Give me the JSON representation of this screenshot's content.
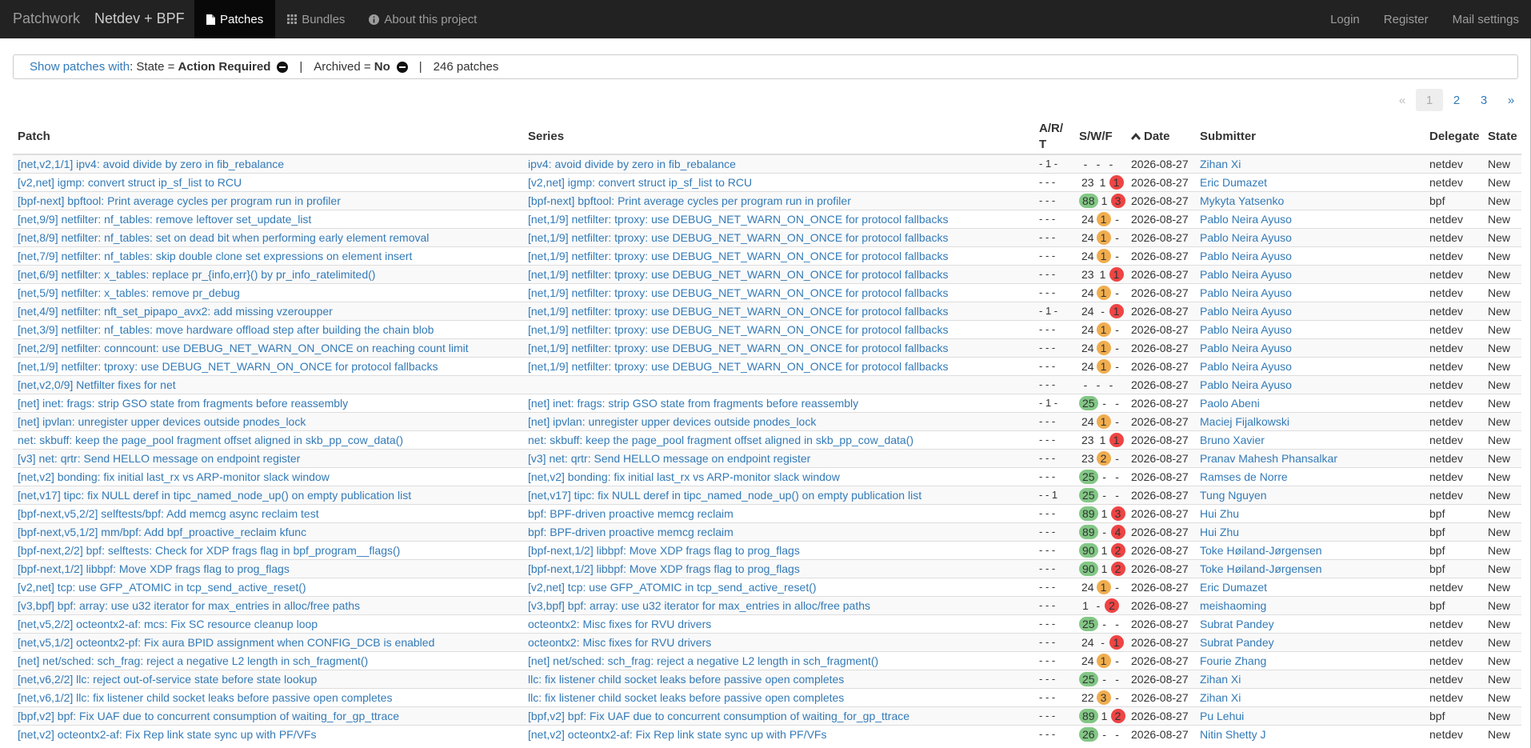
{
  "nav": {
    "brand": "Patchwork",
    "project": "Netdev + BPF",
    "tabs": [
      {
        "label": "Patches",
        "icon": "file-icon",
        "active": true
      },
      {
        "label": "Bundles",
        "icon": "th-icon",
        "active": false
      },
      {
        "label": "About this project",
        "icon": "info-icon",
        "active": false
      }
    ],
    "right": [
      "Login",
      "Register",
      "Mail settings"
    ]
  },
  "filters": {
    "show_label": "Show patches with",
    "state_prefix": ": State = ",
    "state_value": "Action Required",
    "sep1": "|",
    "archived_prefix": "Archived = ",
    "archived_value": "No",
    "sep2": "|",
    "count": "246 patches"
  },
  "pagination": {
    "prev": "«",
    "pages": [
      "1",
      "2",
      "3"
    ],
    "next": "»",
    "current": "1"
  },
  "table": {
    "headers": {
      "patch": "Patch",
      "series": "Series",
      "art": "A/R/T",
      "swf": "S/W/F",
      "date": "Date",
      "submitter": "Submitter",
      "delegate": "Delegate",
      "state": "State"
    },
    "rows": [
      {
        "patch": "[net,v2,1/1] ipv4: avoid divide by zero in fib_rebalance",
        "series": "ipv4: avoid divide by zero in fib_rebalance",
        "art": "- 1 -",
        "s": "-",
        "w": "-",
        "f": "-",
        "date": "2026-08-27",
        "submitter": "Zihan Xi",
        "delegate": "netdev",
        "state": "New"
      },
      {
        "patch": "[v2,net] igmp: convert struct ip_sf_list to RCU",
        "series": "[v2,net] igmp: convert struct ip_sf_list to RCU",
        "art": "- - -",
        "s": "23",
        "w": "1",
        "f": "1",
        "date": "2026-08-27",
        "submitter": "Eric Dumazet",
        "delegate": "netdev",
        "state": "New"
      },
      {
        "patch": "[bpf-next] bpftool: Print average cycles per program run in profiler",
        "series": "[bpf-next] bpftool: Print average cycles per program run in profiler",
        "art": "- - -",
        "s": "88",
        "w": "1",
        "f": "3",
        "date": "2026-08-27",
        "submitter": "Mykyta Yatsenko",
        "delegate": "bpf",
        "state": "New"
      },
      {
        "patch": "[net,9/9] netfilter: nf_tables: remove leftover set_update_list",
        "series": "[net,1/9] netfilter: tproxy: use DEBUG_NET_WARN_ON_ONCE for protocol fallbacks",
        "art": "- - -",
        "s": "24",
        "w": "1",
        "f": "-",
        "date": "2026-08-27",
        "submitter": "Pablo Neira Ayuso",
        "delegate": "netdev",
        "state": "New"
      },
      {
        "patch": "[net,8/9] netfilter: nf_tables: set on dead bit when performing early element removal",
        "series": "[net,1/9] netfilter: tproxy: use DEBUG_NET_WARN_ON_ONCE for protocol fallbacks",
        "art": "- - -",
        "s": "24",
        "w": "1",
        "f": "-",
        "date": "2026-08-27",
        "submitter": "Pablo Neira Ayuso",
        "delegate": "netdev",
        "state": "New"
      },
      {
        "patch": "[net,7/9] netfilter: nf_tables: skip double clone set expressions on element insert",
        "series": "[net,1/9] netfilter: tproxy: use DEBUG_NET_WARN_ON_ONCE for protocol fallbacks",
        "art": "- - -",
        "s": "24",
        "w": "1",
        "f": "-",
        "date": "2026-08-27",
        "submitter": "Pablo Neira Ayuso",
        "delegate": "netdev",
        "state": "New"
      },
      {
        "patch": "[net,6/9] netfilter: x_tables: replace pr_{info,err}() by pr_info_ratelimited()",
        "series": "[net,1/9] netfilter: tproxy: use DEBUG_NET_WARN_ON_ONCE for protocol fallbacks",
        "art": "- - -",
        "s": "23",
        "w": "1",
        "f": "1",
        "date": "2026-08-27",
        "submitter": "Pablo Neira Ayuso",
        "delegate": "netdev",
        "state": "New"
      },
      {
        "patch": "[net,5/9] netfilter: x_tables: remove pr_debug",
        "series": "[net,1/9] netfilter: tproxy: use DEBUG_NET_WARN_ON_ONCE for protocol fallbacks",
        "art": "- - -",
        "s": "24",
        "w": "1",
        "f": "-",
        "date": "2026-08-27",
        "submitter": "Pablo Neira Ayuso",
        "delegate": "netdev",
        "state": "New"
      },
      {
        "patch": "[net,4/9] netfilter: nft_set_pipapo_avx2: add missing vzeroupper",
        "series": "[net,1/9] netfilter: tproxy: use DEBUG_NET_WARN_ON_ONCE for protocol fallbacks",
        "art": "- 1 -",
        "s": "24",
        "w": "-",
        "f": "1",
        "date": "2026-08-27",
        "submitter": "Pablo Neira Ayuso",
        "delegate": "netdev",
        "state": "New"
      },
      {
        "patch": "[net,3/9] netfilter: nf_tables: move hardware offload step after building the chain blob",
        "series": "[net,1/9] netfilter: tproxy: use DEBUG_NET_WARN_ON_ONCE for protocol fallbacks",
        "art": "- - -",
        "s": "24",
        "w": "1",
        "f": "-",
        "date": "2026-08-27",
        "submitter": "Pablo Neira Ayuso",
        "delegate": "netdev",
        "state": "New"
      },
      {
        "patch": "[net,2/9] netfilter: conncount: use DEBUG_NET_WARN_ON_ONCE on reaching count limit",
        "series": "[net,1/9] netfilter: tproxy: use DEBUG_NET_WARN_ON_ONCE for protocol fallbacks",
        "art": "- - -",
        "s": "24",
        "w": "1",
        "f": "-",
        "date": "2026-08-27",
        "submitter": "Pablo Neira Ayuso",
        "delegate": "netdev",
        "state": "New"
      },
      {
        "patch": "[net,1/9] netfilter: tproxy: use DEBUG_NET_WARN_ON_ONCE for protocol fallbacks",
        "series": "[net,1/9] netfilter: tproxy: use DEBUG_NET_WARN_ON_ONCE for protocol fallbacks",
        "art": "- - -",
        "s": "24",
        "w": "1",
        "f": "-",
        "date": "2026-08-27",
        "submitter": "Pablo Neira Ayuso",
        "delegate": "netdev",
        "state": "New"
      },
      {
        "patch": "[net,v2,0/9] Netfilter fixes for net",
        "series": "",
        "art": "- - -",
        "s": "-",
        "w": "-",
        "f": "-",
        "date": "2026-08-27",
        "submitter": "Pablo Neira Ayuso",
        "delegate": "netdev",
        "state": "New"
      },
      {
        "patch": "[net] inet: frags: strip GSO state from fragments before reassembly",
        "series": "[net] inet: frags: strip GSO state from fragments before reassembly",
        "art": "- 1 -",
        "s": "25",
        "w": "-",
        "f": "-",
        "date": "2026-08-27",
        "submitter": "Paolo Abeni",
        "delegate": "netdev",
        "state": "New"
      },
      {
        "patch": "[net] ipvlan: unregister upper devices outside pnodes_lock",
        "series": "[net] ipvlan: unregister upper devices outside pnodes_lock",
        "art": "- - -",
        "s": "24",
        "w": "1",
        "f": "-",
        "date": "2026-08-27",
        "submitter": "Maciej Fijalkowski",
        "delegate": "netdev",
        "state": "New"
      },
      {
        "patch": "net: skbuff: keep the page_pool fragment offset aligned in skb_pp_cow_data()",
        "series": "net: skbuff: keep the page_pool fragment offset aligned in skb_pp_cow_data()",
        "art": "- - -",
        "s": "23",
        "w": "1",
        "f": "1",
        "date": "2026-08-27",
        "submitter": "Bruno Xavier",
        "delegate": "netdev",
        "state": "New"
      },
      {
        "patch": "[v3] net: qrtr: Send HELLO message on endpoint register",
        "series": "[v3] net: qrtr: Send HELLO message on endpoint register",
        "art": "- - -",
        "s": "23",
        "w": "2",
        "f": "-",
        "date": "2026-08-27",
        "submitter": "Pranav Mahesh Phansalkar",
        "delegate": "netdev",
        "state": "New"
      },
      {
        "patch": "[net,v2] bonding: fix initial last_rx vs ARP-monitor slack window",
        "series": "[net,v2] bonding: fix initial last_rx vs ARP-monitor slack window",
        "art": "- - -",
        "s": "25",
        "w": "-",
        "f": "-",
        "date": "2026-08-27",
        "submitter": "Ramses de Norre",
        "delegate": "netdev",
        "state": "New"
      },
      {
        "patch": "[net,v17] tipc: fix NULL deref in tipc_named_node_up() on empty publication list",
        "series": "[net,v17] tipc: fix NULL deref in tipc_named_node_up() on empty publication list",
        "art": "- - 1",
        "s": "25",
        "w": "-",
        "f": "-",
        "date": "2026-08-27",
        "submitter": "Tung Nguyen",
        "delegate": "netdev",
        "state": "New"
      },
      {
        "patch": "[bpf-next,v5,2/2] selftests/bpf: Add memcg async reclaim test",
        "series": "bpf: BPF-driven proactive memcg reclaim",
        "art": "- - -",
        "s": "89",
        "w": "1",
        "f": "3",
        "date": "2026-08-27",
        "submitter": "Hui Zhu",
        "delegate": "bpf",
        "state": "New"
      },
      {
        "patch": "[bpf-next,v5,1/2] mm/bpf: Add bpf_proactive_reclaim kfunc",
        "series": "bpf: BPF-driven proactive memcg reclaim",
        "art": "- - -",
        "s": "89",
        "w": "-",
        "f": "4",
        "date": "2026-08-27",
        "submitter": "Hui Zhu",
        "delegate": "bpf",
        "state": "New"
      },
      {
        "patch": "[bpf-next,2/2] bpf: selftests: Check for XDP frags flag in bpf_program__flags()",
        "series": "[bpf-next,1/2] libbpf: Move XDP frags flag to prog_flags",
        "art": "- - -",
        "s": "90",
        "w": "1",
        "f": "2",
        "date": "2026-08-27",
        "submitter": "Toke Høiland-Jørgensen",
        "delegate": "bpf",
        "state": "New"
      },
      {
        "patch": "[bpf-next,1/2] libbpf: Move XDP frags flag to prog_flags",
        "series": "[bpf-next,1/2] libbpf: Move XDP frags flag to prog_flags",
        "art": "- - -",
        "s": "90",
        "w": "1",
        "f": "2",
        "date": "2026-08-27",
        "submitter": "Toke Høiland-Jørgensen",
        "delegate": "bpf",
        "state": "New"
      },
      {
        "patch": "[v2,net] tcp: use GFP_ATOMIC in tcp_send_active_reset()",
        "series": "[v2,net] tcp: use GFP_ATOMIC in tcp_send_active_reset()",
        "art": "- - -",
        "s": "24",
        "w": "1",
        "f": "-",
        "date": "2026-08-27",
        "submitter": "Eric Dumazet",
        "delegate": "netdev",
        "state": "New"
      },
      {
        "patch": "[v3,bpf] bpf: array: use u32 iterator for max_entries in alloc/free paths",
        "series": "[v3,bpf] bpf: array: use u32 iterator for max_entries in alloc/free paths",
        "art": "- - -",
        "s": "1",
        "w": "-",
        "f": "2",
        "date": "2026-08-27",
        "submitter": "meishaoming",
        "delegate": "bpf",
        "state": "New"
      },
      {
        "patch": "[net,v5,2/2] octeontx2-af: mcs: Fix SC resource cleanup loop",
        "series": "octeontx2: Misc fixes for RVU drivers",
        "art": "- - -",
        "s": "25",
        "w": "-",
        "f": "-",
        "date": "2026-08-27",
        "submitter": "Subrat Pandey",
        "delegate": "netdev",
        "state": "New"
      },
      {
        "patch": "[net,v5,1/2] octeontx2-pf: Fix aura BPID assignment when CONFIG_DCB is enabled",
        "series": "octeontx2: Misc fixes for RVU drivers",
        "art": "- - -",
        "s": "24",
        "w": "-",
        "f": "1",
        "date": "2026-08-27",
        "submitter": "Subrat Pandey",
        "delegate": "netdev",
        "state": "New"
      },
      {
        "patch": "[net] net/sched: sch_frag: reject a negative L2 length in sch_fragment()",
        "series": "[net] net/sched: sch_frag: reject a negative L2 length in sch_fragment()",
        "art": "- - -",
        "s": "24",
        "w": "1",
        "f": "-",
        "date": "2026-08-27",
        "submitter": "Fourie Zhang",
        "delegate": "netdev",
        "state": "New"
      },
      {
        "patch": "[net,v6,2/2] llc: reject out-of-service state before state lookup",
        "series": "llc: fix listener child socket leaks before passive open completes",
        "art": "- - -",
        "s": "25",
        "w": "-",
        "f": "-",
        "date": "2026-08-27",
        "submitter": "Zihan Xi",
        "delegate": "netdev",
        "state": "New"
      },
      {
        "patch": "[net,v6,1/2] llc: fix listener child socket leaks before passive open completes",
        "series": "llc: fix listener child socket leaks before passive open completes",
        "art": "- - -",
        "s": "22",
        "w": "3",
        "f": "-",
        "date": "2026-08-27",
        "submitter": "Zihan Xi",
        "delegate": "netdev",
        "state": "New"
      },
      {
        "patch": "[bpf,v2] bpf: Fix UAF due to concurrent consumption of waiting_for_gp_ttrace",
        "series": "[bpf,v2] bpf: Fix UAF due to concurrent consumption of waiting_for_gp_ttrace",
        "art": "- - -",
        "s": "89",
        "w": "1",
        "f": "2",
        "date": "2026-08-27",
        "submitter": "Pu Lehui",
        "delegate": "bpf",
        "state": "New"
      },
      {
        "patch": "[net,v2] octeontx2-af: Fix Rep link state sync up with PF/VFs",
        "series": "[net,v2] octeontx2-af: Fix Rep link state sync up with PF/VFs",
        "art": "- - -",
        "s": "26",
        "w": "-",
        "f": "-",
        "date": "2026-08-27",
        "submitter": "Nitin Shetty J",
        "delegate": "netdev",
        "state": "New"
      }
    ]
  },
  "colors": {
    "success": "#82c785",
    "warning": "#f0ad4e",
    "danger": "#e44",
    "link": "#337ab7",
    "navbar": "#222"
  }
}
